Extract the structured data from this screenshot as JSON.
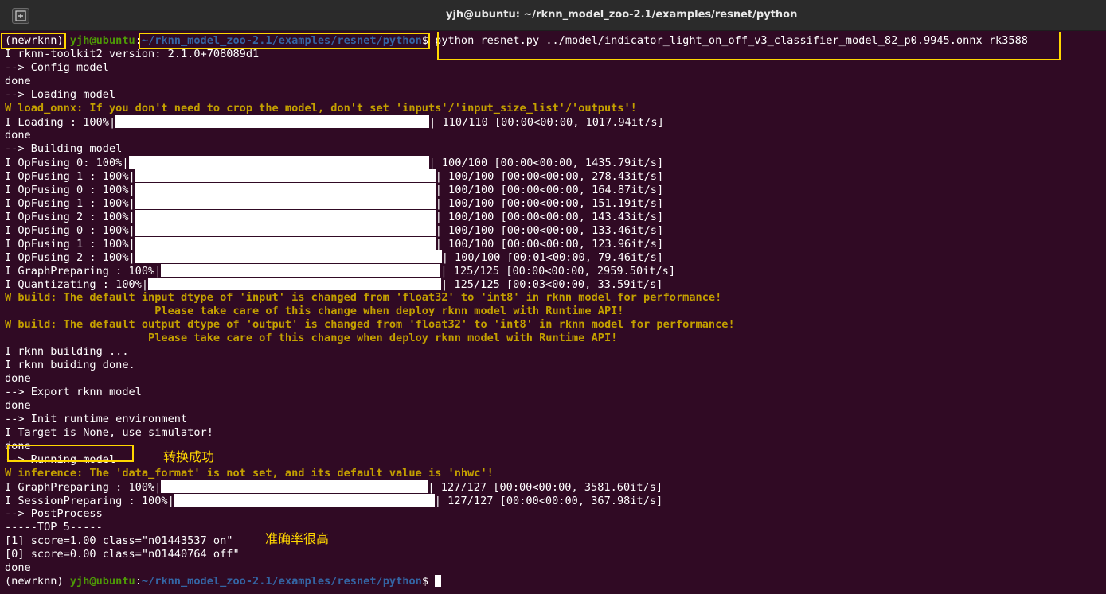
{
  "window": {
    "title": "yjh@ubuntu: ~/rknn_model_zoo-2.1/examples/resnet/python"
  },
  "prompt": {
    "env": "(newrknn)",
    "user_host": "yjh@ubuntu",
    "sep": ":",
    "path": "~/rknn_model_zoo-2.1/examples/resnet/python",
    "symbol": "$",
    "command": " python resnet.py ../model/indicator_light_on_off_v3_classifier_model_82_p0.9945.onnx rk3588"
  },
  "lines": {
    "version": "I rknn-toolkit2 version: 2.1.0+708089d1",
    "config": "--> Config model",
    "done1": "done",
    "loading": "--> Loading model",
    "warn_onnx": "W load_onnx: If you don't need to crop the model, don't set 'inputs'/'input_size_list'/'outputs'!",
    "progress_loading_label": "I Loading : 100%|",
    "progress_loading_tail": "| 110/110 [00:00<00:00, 1017.94it/s]",
    "done2": "done",
    "building": "--> Building model",
    "opf0a_label": "I OpFusing 0: 100%|",
    "opf0a_tail": "| 100/100 [00:00<00:00, 1435.79it/s]",
    "opf1a_label": "I OpFusing 1 : 100%|",
    "opf1a_tail": "| 100/100 [00:00<00:00, 278.43it/s]",
    "opf0b_label": "I OpFusing 0 : 100%|",
    "opf0b_tail": "| 100/100 [00:00<00:00, 164.87it/s]",
    "opf1b_label": "I OpFusing 1 : 100%|",
    "opf1b_tail": "| 100/100 [00:00<00:00, 151.19it/s]",
    "opf2a_label": "I OpFusing 2 : 100%|",
    "opf2a_tail": "| 100/100 [00:00<00:00, 143.43it/s]",
    "opf0c_label": "I OpFusing 0 : 100%|",
    "opf0c_tail": "| 100/100 [00:00<00:00, 133.46it/s]",
    "opf1c_label": "I OpFusing 1 : 100%|",
    "opf1c_tail": "| 100/100 [00:00<00:00, 123.96it/s]",
    "opf2b_label": "I OpFusing 2 : 100%|",
    "opf2b_tail": "| 100/100 [00:01<00:00, 79.46it/s]",
    "graph1_label": "I GraphPreparing : 100%|",
    "graph1_tail": "| 125/125 [00:00<00:00, 2959.50it/s]",
    "quant_label": "I Quantizating : 100%|",
    "quant_tail": "| 125/125 [00:03<00:00, 33.59it/s]",
    "warn_in1": "W build: The default input dtype of 'input' is changed from 'float32' to 'int8' in rknn model for performance!",
    "warn_in2": "                       Please take care of this change when deploy rknn model with Runtime API!",
    "warn_out1": "W build: The default output dtype of 'output' is changed from 'float32' to 'int8' in rknn model for performance!",
    "warn_out2": "                      Please take care of this change when deploy rknn model with Runtime API!",
    "rknn_building": "I rknn building ...",
    "rknn_buiding_done": "I rknn buiding done.",
    "done3": "done",
    "export": "--> Export rknn model",
    "done4": "done",
    "init_rt": "--> Init runtime environment",
    "target": "I Target is None, use simulator!",
    "done5": "done",
    "running": "--> Running model",
    "warn_inference": "W inference: The 'data_format' is not set, and its default value is 'nhwc'!",
    "graph2_label": "I GraphPreparing : 100%|",
    "graph2_tail": "| 127/127 [00:00<00:00, 3581.60it/s]",
    "session_label": "I SessionPreparing : 100%|",
    "session_tail": "| 127/127 [00:00<00:00, 367.98it/s]",
    "postprocess": "--> PostProcess",
    "top5": "-----TOP 5-----",
    "res1": "[1] score=1.00 class=\"n01443537 on\"",
    "res0": "[0] score=0.00 class=\"n01440764 off\"",
    "done6": "done"
  },
  "annotations": {
    "success": "转换成功",
    "accuracy": "准确率很高"
  },
  "colors": {
    "background": "#300a24",
    "warning": "#c4a000",
    "prompt_user": "#4e9a06",
    "prompt_path": "#3465a4",
    "highlight_box": "#ffd700"
  }
}
